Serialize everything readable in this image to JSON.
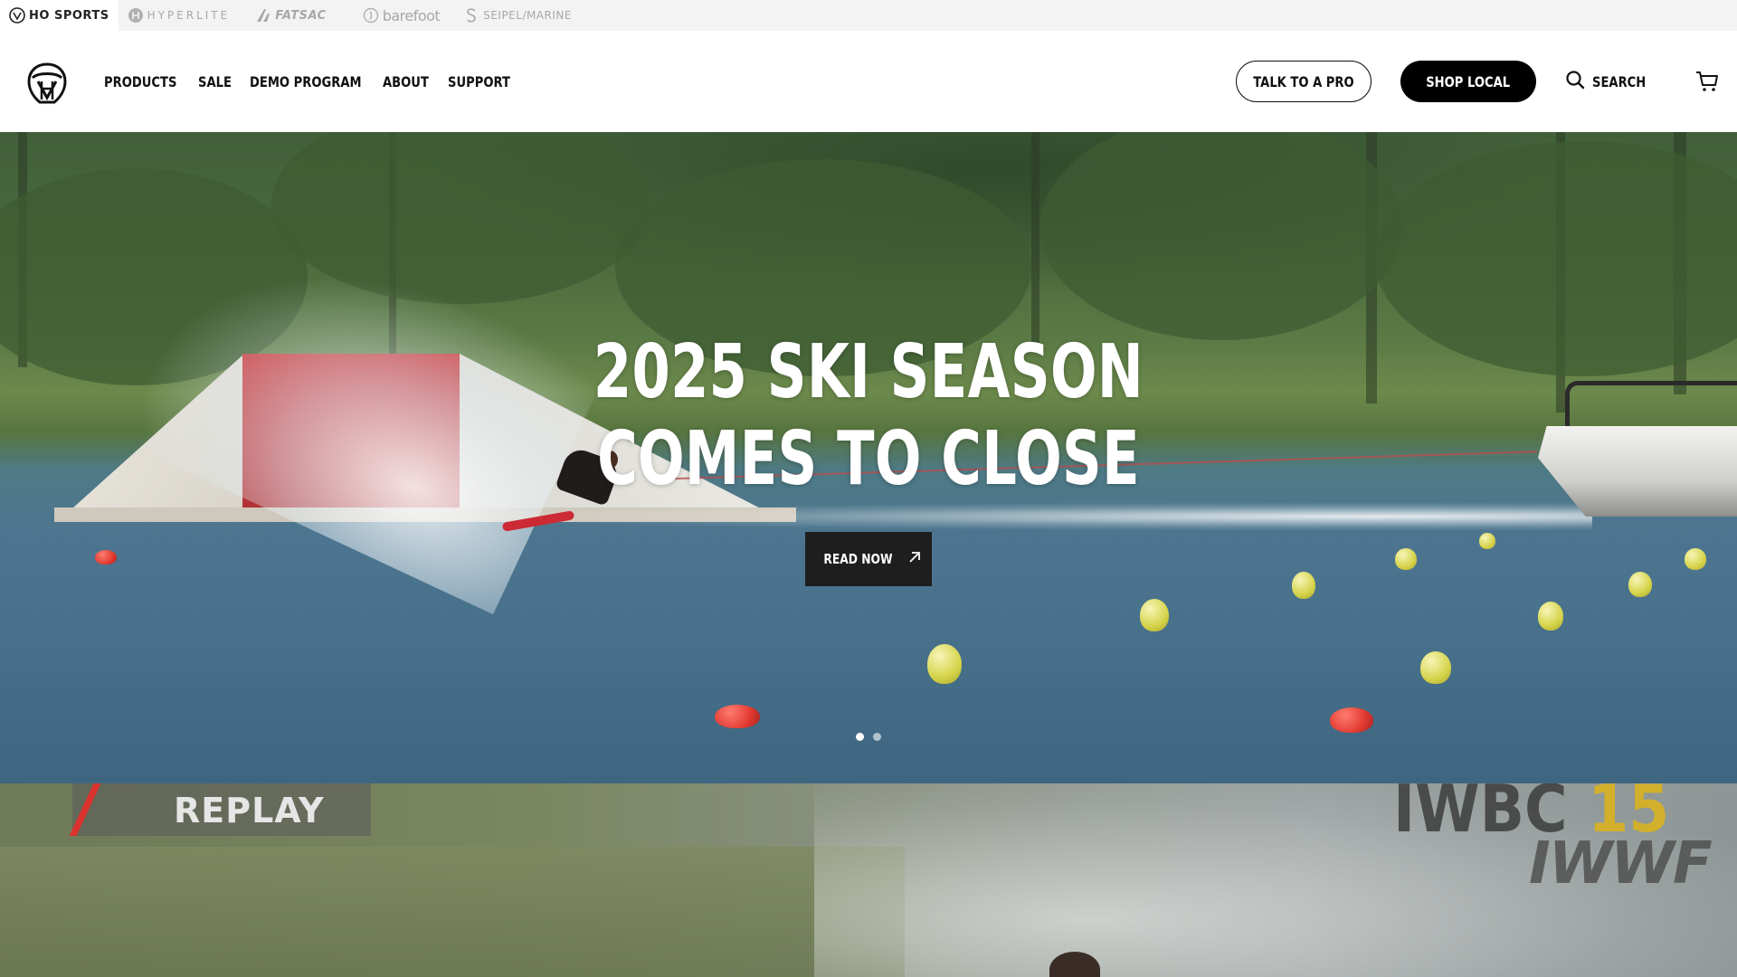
{
  "brand_strip": {
    "brands": [
      {
        "name": "HO SPORTS",
        "active": true
      },
      {
        "name": "HYPERLITE",
        "active": false
      },
      {
        "name": "FATSAC",
        "active": false
      },
      {
        "name": "barefoot",
        "active": false
      },
      {
        "name": "SEIPEL/MARINE",
        "active": false
      }
    ]
  },
  "header": {
    "logo": "ho-sports-helmet-logo",
    "nav": [
      "PRODUCTS",
      "SALE",
      "DEMO PROGRAM",
      "ABOUT",
      "SUPPORT"
    ],
    "talk_to_pro": "TALK TO A PRO",
    "shop_local": "SHOP LOCAL",
    "search_label": "SEARCH",
    "cart_icon": "cart-icon"
  },
  "hero": {
    "title": "2025 SKI SEASON COMES TO CLOSE",
    "cta_label": "READ NOW",
    "cta_icon": "arrow-up-right-icon",
    "slides_total": 2,
    "active_slide": 1
  },
  "video_section": {
    "replay_label": "REPLAY",
    "event_name": "IWBC",
    "event_number": "15",
    "organizer": "IWWF"
  },
  "colors": {
    "primary": "#000000",
    "accent_yellow": "#d2b02c",
    "replay_red": "#d9322f"
  }
}
